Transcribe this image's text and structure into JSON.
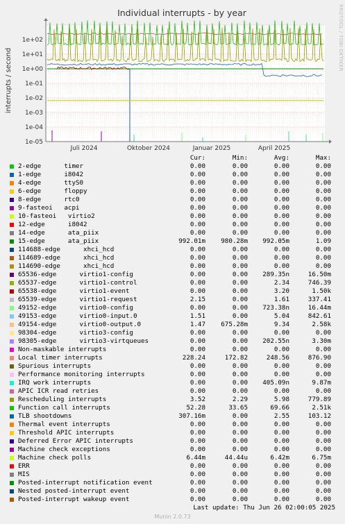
{
  "chart_data": {
    "type": "line",
    "title": "Individual interrupts - by year",
    "ylabel": "interrupts / second",
    "yscale": "log",
    "ylim": [
      1e-05,
      1000
    ],
    "yticks": [
      "1e+02",
      "1e+01",
      "1e+00",
      "1e-01",
      "1e-02",
      "1e-03",
      "1e-04",
      "1e-05"
    ],
    "xticks": [
      "Juli 2024",
      "Oktober 2024",
      "Januar 2025",
      "April 2025"
    ],
    "grid": true,
    "series_colors": {
      "Local timer interrupts": "#dd4444",
      "Function call interrupts": "#22bb22",
      "15-edge ata_piix": "#999900",
      "TLB shootdowns": "#1a5fb4",
      "Machine check polls": "#cccc00",
      "IRQ work interrupts": "#33ddaa",
      "9-fasteoi acpi": "#990099"
    }
  },
  "legend": {
    "header": {
      "cur": "Cur:",
      "min": "Min:",
      "avg": "Avg:",
      "max": "Max:"
    },
    "rows": [
      {
        "name": "2-edge      timer",
        "color": "#00cc00",
        "cur": "0.00",
        "min": "0.00",
        "avg": "0.00",
        "max": "0.00"
      },
      {
        "name": "1-edge      i8042",
        "color": "#0066b3",
        "cur": "0.00",
        "min": "0.00",
        "avg": "0.00",
        "max": "0.00"
      },
      {
        "name": "4-edge      ttyS0",
        "color": "#ff8000",
        "cur": "0.00",
        "min": "0.00",
        "avg": "0.00",
        "max": "0.00"
      },
      {
        "name": "6-edge      floppy",
        "color": "#ffcc00",
        "cur": "0.00",
        "min": "0.00",
        "avg": "0.00",
        "max": "0.00"
      },
      {
        "name": "8-edge      rtc0",
        "color": "#330099",
        "cur": "0.00",
        "min": "0.00",
        "avg": "0.00",
        "max": "0.00"
      },
      {
        "name": "9-fasteoi   acpi",
        "color": "#990099",
        "cur": "0.00",
        "min": "0.00",
        "avg": "0.00",
        "max": "0.00"
      },
      {
        "name": "10-fasteoi   virtio2",
        "color": "#ccff00",
        "cur": "0.00",
        "min": "0.00",
        "avg": "0.00",
        "max": "0.00"
      },
      {
        "name": "12-edge      i8042",
        "color": "#ff0000",
        "cur": "0.00",
        "min": "0.00",
        "avg": "0.00",
        "max": "0.00"
      },
      {
        "name": "14-edge      ata_piix",
        "color": "#808080",
        "cur": "0.00",
        "min": "0.00",
        "avg": "0.00",
        "max": "0.00"
      },
      {
        "name": "15-edge      ata_piix",
        "color": "#008f00",
        "cur": "992.01m",
        "min": "980.28m",
        "avg": "992.05m",
        "max": "1.09"
      },
      {
        "name": "114688-edge      xhci_hcd",
        "color": "#00487d",
        "cur": "0.00",
        "min": "0.00",
        "avg": "0.00",
        "max": "0.00"
      },
      {
        "name": "114689-edge      xhci_hcd",
        "color": "#b35a00",
        "cur": "0.00",
        "min": "0.00",
        "avg": "0.00",
        "max": "0.00"
      },
      {
        "name": "114690-edge      xhci_hcd",
        "color": "#b38f00",
        "cur": "0.00",
        "min": "0.00",
        "avg": "0.00",
        "max": "0.00"
      },
      {
        "name": "65536-edge      virtio1-config",
        "color": "#6b006b",
        "cur": "0.00",
        "min": "0.00",
        "avg": "289.35n",
        "max": "16.50m"
      },
      {
        "name": "65537-edge      virtio1-control",
        "color": "#8fb300",
        "cur": "0.00",
        "min": "0.00",
        "avg": "2.34",
        "max": "746.39"
      },
      {
        "name": "65538-edge      virtio1-event",
        "color": "#b30000",
        "cur": "0.00",
        "min": "0.00",
        "avg": "3.20",
        "max": "1.50k"
      },
      {
        "name": "65539-edge      virtio1-request",
        "color": "#bebebe",
        "cur": "2.15",
        "min": "0.00",
        "avg": "1.61",
        "max": "337.41"
      },
      {
        "name": "49152-edge      virtio0-config",
        "color": "#80ff80",
        "cur": "0.00",
        "min": "0.00",
        "avg": "723.38n",
        "max": "16.44m"
      },
      {
        "name": "49153-edge      virtio0-input.0",
        "color": "#80c9ff",
        "cur": "1.51",
        "min": "0.00",
        "avg": "5.04",
        "max": "842.61"
      },
      {
        "name": "49154-edge      virtio0-output.0",
        "color": "#ffc080",
        "cur": "1.47",
        "min": "675.28m",
        "avg": "9.34",
        "max": "2.58k"
      },
      {
        "name": "98304-edge      virtio3-config",
        "color": "#ffe680",
        "cur": "0.00",
        "min": "0.00",
        "avg": "0.00",
        "max": "0.00"
      },
      {
        "name": "98305-edge      virtio3-virtqueues",
        "color": "#aa80ff",
        "cur": "0.00",
        "min": "0.00",
        "avg": "202.55n",
        "max": "3.30m"
      },
      {
        "name": "Non-maskable interrupts",
        "color": "#ee00cc",
        "cur": "0.00",
        "min": "0.00",
        "avg": "0.00",
        "max": "0.00"
      },
      {
        "name": "Local timer interrupts",
        "color": "#ff8080",
        "cur": "228.24",
        "min": "172.82",
        "avg": "248.56",
        "max": "876.90"
      },
      {
        "name": "Spurious interrupts",
        "color": "#666600",
        "cur": "0.00",
        "min": "0.00",
        "avg": "0.00",
        "max": "0.00"
      },
      {
        "name": "Performance monitoring interrupts",
        "color": "#ffbfff",
        "cur": "0.00",
        "min": "0.00",
        "avg": "0.00",
        "max": "0.00"
      },
      {
        "name": "IRQ work interrupts",
        "color": "#00ffcc",
        "cur": "0.00",
        "min": "0.00",
        "avg": "405.09n",
        "max": "9.87m"
      },
      {
        "name": "APIC ICR read retries",
        "color": "#cc6699",
        "cur": "0.00",
        "min": "0.00",
        "avg": "0.00",
        "max": "0.00"
      },
      {
        "name": "Rescheduling interrupts",
        "color": "#999900",
        "cur": "3.52",
        "min": "2.29",
        "avg": "5.98",
        "max": "779.89"
      },
      {
        "name": "Function call interrupts",
        "color": "#00cc00",
        "cur": "52.28",
        "min": "33.65",
        "avg": "69.66",
        "max": "2.51k"
      },
      {
        "name": "TLB shootdowns",
        "color": "#0066b3",
        "cur": "307.16m",
        "min": "0.00",
        "avg": "2.55",
        "max": "103.12"
      },
      {
        "name": "Thermal event interrupts",
        "color": "#ff8000",
        "cur": "0.00",
        "min": "0.00",
        "avg": "0.00",
        "max": "0.00"
      },
      {
        "name": "Threshold APIC interrupts",
        "color": "#ffcc00",
        "cur": "0.00",
        "min": "0.00",
        "avg": "0.00",
        "max": "0.00"
      },
      {
        "name": "Deferred Error APIC interrupts",
        "color": "#330099",
        "cur": "0.00",
        "min": "0.00",
        "avg": "0.00",
        "max": "0.00"
      },
      {
        "name": "Machine check exceptions",
        "color": "#990099",
        "cur": "0.00",
        "min": "0.00",
        "avg": "0.00",
        "max": "0.00"
      },
      {
        "name": "Machine check polls",
        "color": "#ccff00",
        "cur": "6.44m",
        "min": "44.44u",
        "avg": "6.42m",
        "max": "6.75m"
      },
      {
        "name": "ERR",
        "color": "#ff0000",
        "cur": "0.00",
        "min": "0.00",
        "avg": "0.00",
        "max": "0.00"
      },
      {
        "name": "MIS",
        "color": "#808080",
        "cur": "0.00",
        "min": "0.00",
        "avg": "0.00",
        "max": "0.00"
      },
      {
        "name": "Posted-interrupt notification event",
        "color": "#008f00",
        "cur": "0.00",
        "min": "0.00",
        "avg": "0.00",
        "max": "0.00"
      },
      {
        "name": "Nested posted-interrupt event",
        "color": "#00487d",
        "cur": "0.00",
        "min": "0.00",
        "avg": "0.00",
        "max": "0.00"
      },
      {
        "name": "Posted-interrupt wakeup event",
        "color": "#b35a00",
        "cur": "0.00",
        "min": "0.00",
        "avg": "0.00",
        "max": "0.00"
      }
    ]
  },
  "last_update": "Last update: Thu Jun 26 02:00:05 2025",
  "footer": "Munin 2.0.73",
  "side_label": "RRDTOOL / TOBI OETIKER"
}
